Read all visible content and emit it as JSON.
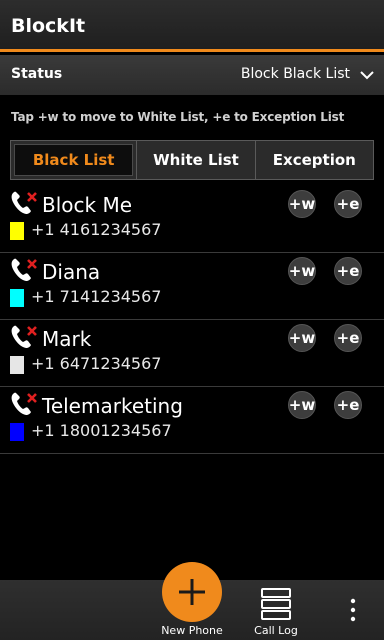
{
  "app": {
    "title": "BlockIt"
  },
  "status": {
    "label": "Status",
    "value": "Block Black List"
  },
  "hint": "Tap +w to move to White List, +e to Exception List",
  "tabs": [
    {
      "label": "Black List",
      "active": true
    },
    {
      "label": "White List",
      "active": false
    },
    {
      "label": "Exception",
      "active": false
    }
  ],
  "contacts": [
    {
      "name": "Block Me",
      "number": "+1 4161234567",
      "color": "#ffff00"
    },
    {
      "name": "Diana",
      "number": "+1 7141234567",
      "color": "#00ffff"
    },
    {
      "name": "Mark",
      "number": "+1 6471234567",
      "color": "#e6e6e6"
    },
    {
      "name": "Telemarketing",
      "number": "+1 18001234567",
      "color": "#0000ff"
    }
  ],
  "buttons": {
    "white": "+w",
    "exception": "+e"
  },
  "bottom": {
    "new_phone": "New Phone",
    "call_log": "Call Log"
  },
  "colors": {
    "accent": "#f08a1c"
  }
}
